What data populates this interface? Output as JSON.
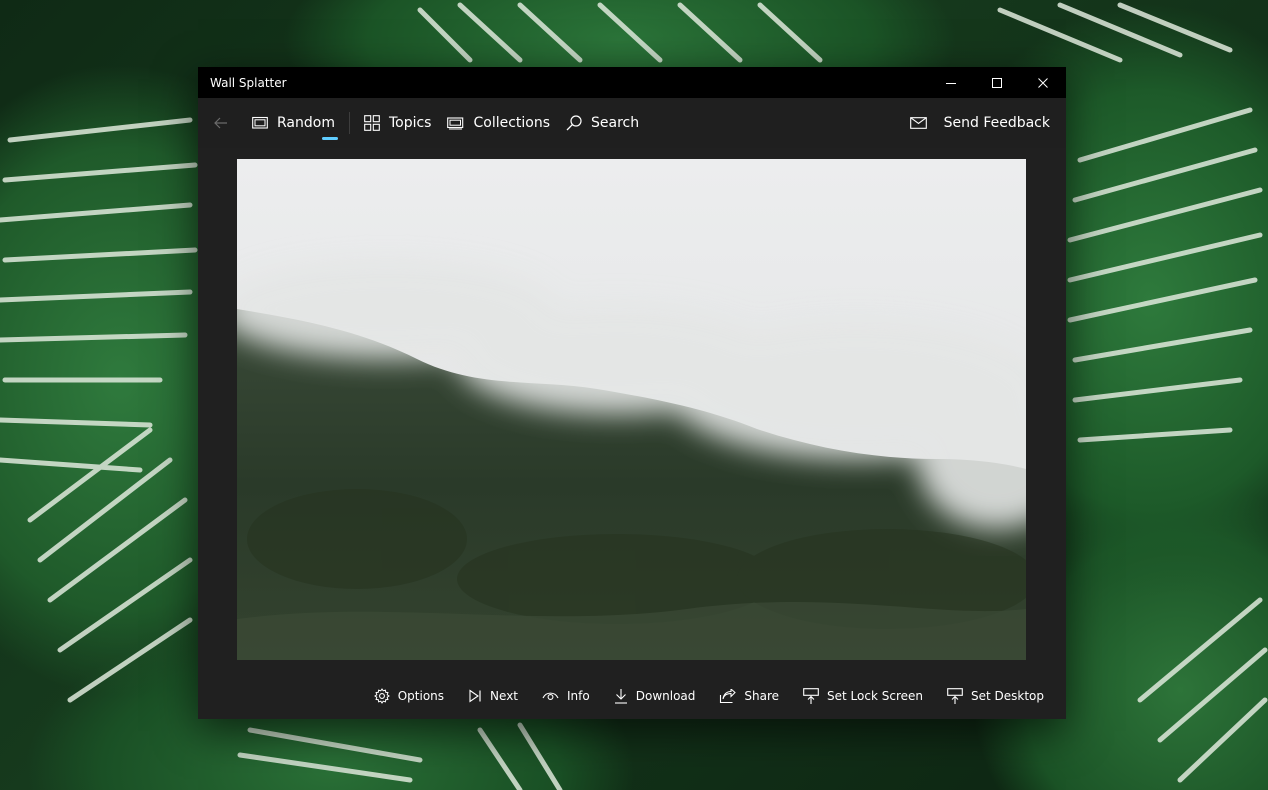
{
  "window": {
    "title": "Wall Splatter"
  },
  "nav": {
    "items": [
      {
        "label": "Random",
        "icon": "random-icon",
        "selected": true
      },
      {
        "label": "Topics",
        "icon": "grid-icon"
      },
      {
        "label": "Collections",
        "icon": "collections-icon"
      },
      {
        "label": "Search",
        "icon": "search-icon"
      }
    ],
    "feedback_label": "Send Feedback"
  },
  "commands": [
    {
      "label": "Options",
      "icon": "gear-icon"
    },
    {
      "label": "Next",
      "icon": "next-icon"
    },
    {
      "label": "Info",
      "icon": "eye-icon"
    },
    {
      "label": "Download",
      "icon": "download-icon"
    },
    {
      "label": "Share",
      "icon": "share-icon"
    },
    {
      "label": "Set Lock Screen",
      "icon": "lock-screen-icon"
    },
    {
      "label": "Set Desktop",
      "icon": "desktop-icon"
    }
  ],
  "colors": {
    "accent": "#60cdff",
    "window_bg": "#202020",
    "titlebar_bg": "#000000"
  }
}
